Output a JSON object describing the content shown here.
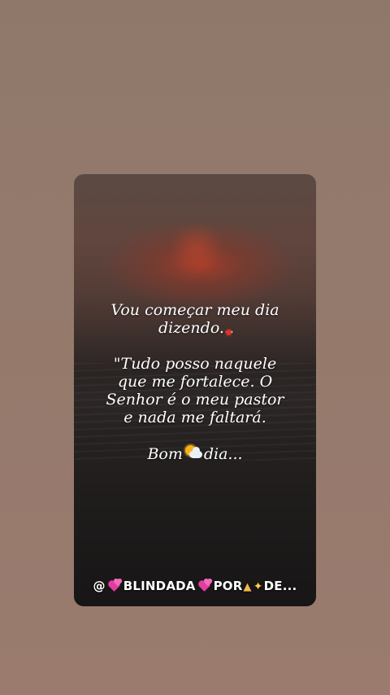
{
  "post": {
    "message_lines_1": [
      "Vou começar meu dia",
      "dizendo..."
    ],
    "message_lines_2": [
      "\"Tudo posso naquele",
      "que me fortalece. O",
      "Senhor é o meu pastor",
      "e nada me faltará."
    ],
    "greeting": {
      "before": "Bom",
      "after": "dia..."
    },
    "footer": {
      "at": "@",
      "part1": "BLINDADA",
      "part2": "POR",
      "part3": "DE..."
    }
  },
  "icons": {
    "heart_dot": "red-heart-dot-icon",
    "sun_cloud": "sun-behind-cloud-icon",
    "hearts": "two-hearts-icon",
    "pray": "folded-hands-icon",
    "sparkles": "sparkles-icon"
  },
  "colors": {
    "background": "#947a6c",
    "card_top": "#5b4a43",
    "card_bottom": "#171515",
    "sun": "#af3c28",
    "text": "#ffffff",
    "hearts": "#e23c9e"
  }
}
